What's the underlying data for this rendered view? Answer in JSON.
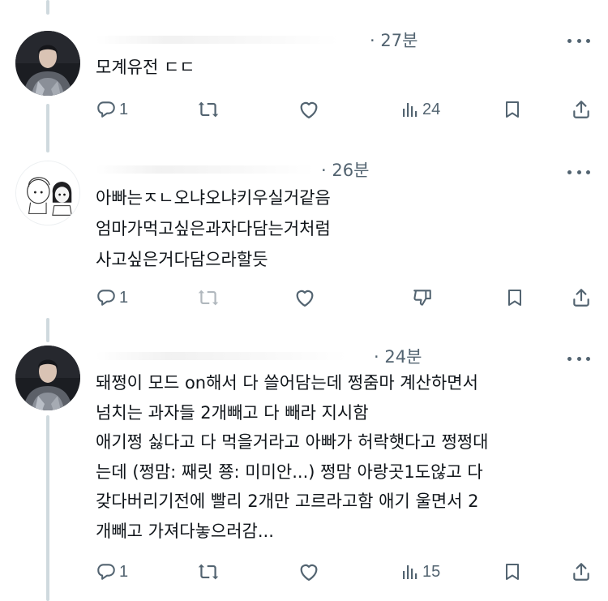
{
  "tweets": [
    {
      "time": "· 27분",
      "text_lines": [
        "모계유전 ㄷㄷ"
      ],
      "reply_count": "1",
      "view_count": "24"
    },
    {
      "time": "· 26분",
      "text_lines": [
        "아빠는ㅈㄴ오냐오냐키우실거같음",
        "엄마가먹고싶은과자다담는거처럼",
        "사고싶은거다담으라할듯"
      ],
      "reply_count": "1"
    },
    {
      "time": "· 24분",
      "text_lines": [
        "돼쩡이 모드 on해서 다 쓸어담는데 쩡줌마 계산하면서",
        "넘치는 과자들 2개빼고 다 빼라 지시함",
        "애기쩡 싫다고 다 먹을거라고 아빠가 허락햇다고 쩡쩡대",
        "는데 (쩡맘: 째릿 쭁: 미미안...) 쩡맘 아랑곳1도않고 다",
        "갖다버리기전에 빨리 2개만 고르라고함 애기 울면서 2",
        "개빼고 가져다놓으러감..."
      ],
      "reply_count": "1",
      "view_count": "15"
    }
  ],
  "colors": {
    "text": "#0f1419",
    "muted": "#536471",
    "thread_line": "#cfd9de"
  },
  "icons": [
    "reply-icon",
    "retweet-icon",
    "like-icon",
    "views-icon",
    "bookmark-icon",
    "share-icon",
    "more-icon",
    "downvote-icon"
  ]
}
